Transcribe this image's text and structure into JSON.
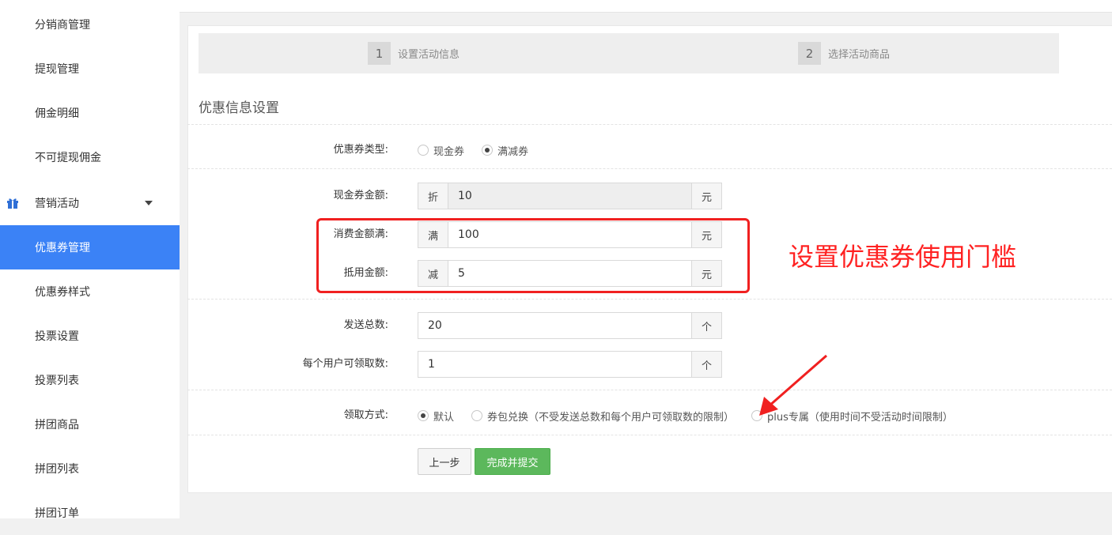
{
  "sidebar": {
    "items": [
      {
        "label": "分销商管理"
      },
      {
        "label": "提现管理"
      },
      {
        "label": "佣金明细"
      },
      {
        "label": "不可提现佣金"
      },
      {
        "label": "营销活动"
      },
      {
        "label": "优惠券管理"
      },
      {
        "label": "优惠券样式"
      },
      {
        "label": "投票设置"
      },
      {
        "label": "投票列表"
      },
      {
        "label": "拼团商品"
      },
      {
        "label": "拼团列表"
      },
      {
        "label": "拼团订单"
      }
    ],
    "group_icon": "gift-icon",
    "active_color": "#3b82f6"
  },
  "steps": [
    {
      "num": "1",
      "label": "设置活动信息"
    },
    {
      "num": "2",
      "label": "选择活动商品"
    }
  ],
  "section_title": "优惠信息设置",
  "form": {
    "coupon_type": {
      "label": "优惠券类型:",
      "options": [
        {
          "label": "现金券",
          "checked": false
        },
        {
          "label": "满减券",
          "checked": true
        }
      ]
    },
    "cash_amount": {
      "label": "现金券金额:",
      "prefix": "折",
      "value": "10",
      "suffix": "元"
    },
    "min_spend": {
      "label": "消费金额满:",
      "prefix": "满",
      "value": "100",
      "suffix": "元"
    },
    "deduct_amount": {
      "label": "抵用金额:",
      "prefix": "减",
      "value": "5",
      "suffix": "元"
    },
    "total_send": {
      "label": "发送总数:",
      "value": "20",
      "suffix": "个"
    },
    "per_user": {
      "label": "每个用户可领取数:",
      "value": "1",
      "suffix": "个"
    },
    "claim_method": {
      "label": "领取方式:",
      "options": [
        {
          "label": "默认",
          "checked": true
        },
        {
          "label": "券包兑换（不受发送总数和每个用户可领取数的限制）",
          "checked": false
        },
        {
          "label": "plus专属（使用时间不受活动时间限制）",
          "checked": false
        }
      ]
    }
  },
  "buttons": {
    "prev": "上一步",
    "submit": "完成并提交"
  },
  "annotation": {
    "text": "设置优惠券使用门槛",
    "color": "#f22222"
  }
}
